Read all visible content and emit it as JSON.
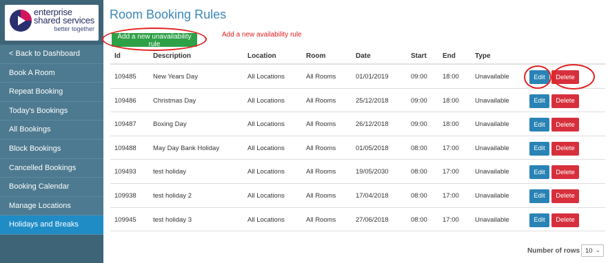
{
  "logo": {
    "line1": "enterprise",
    "line2": "shared services",
    "line3": "better together"
  },
  "sidebar": {
    "items": [
      {
        "label": "< Back to Dashboard"
      },
      {
        "label": "Book A Room"
      },
      {
        "label": "Repeat Booking"
      },
      {
        "label": "Today's Bookings"
      },
      {
        "label": "All Bookings"
      },
      {
        "label": "Block Bookings"
      },
      {
        "label": "Cancelled Bookings"
      },
      {
        "label": "Booking Calendar"
      },
      {
        "label": "Manage Locations"
      },
      {
        "label": "Holidays and Breaks"
      }
    ]
  },
  "main": {
    "title": "Room Booking Rules",
    "add_button_label": "Add a new unavailability rule",
    "annotation": "Add a new availability rule"
  },
  "table": {
    "headers": {
      "id": "Id",
      "description": "Description",
      "location": "Location",
      "room": "Room",
      "date": "Date",
      "start": "Start",
      "end": "End",
      "type": "Type"
    },
    "rows": [
      {
        "id": "109485",
        "description": "New Years Day",
        "location": "All Locations",
        "room": "All Rooms",
        "date": "01/01/2019",
        "start": "09:00",
        "end": "18:00",
        "type": "Unavailable"
      },
      {
        "id": "109486",
        "description": "Christmas Day",
        "location": "All Locations",
        "room": "All Rooms",
        "date": "25/12/2018",
        "start": "09:00",
        "end": "18:00",
        "type": "Unavailable"
      },
      {
        "id": "109487",
        "description": "Boxing Day",
        "location": "All Locations",
        "room": "All Rooms",
        "date": "26/12/2018",
        "start": "09:00",
        "end": "18:00",
        "type": "Unavailable"
      },
      {
        "id": "109488",
        "description": "May Day Bank Holiday",
        "location": "All Locations",
        "room": "All Rooms",
        "date": "01/05/2018",
        "start": "08:00",
        "end": "17:00",
        "type": "Unavailable"
      },
      {
        "id": "109493",
        "description": "test holiday",
        "location": "All Locations",
        "room": "All Rooms",
        "date": "19/05/2030",
        "start": "08:00",
        "end": "17:00",
        "type": "Unavailable"
      },
      {
        "id": "109938",
        "description": "test holiday 2",
        "location": "All Locations",
        "room": "All Rooms",
        "date": "17/04/2018",
        "start": "08:00",
        "end": "17:00",
        "type": "Unavailable"
      },
      {
        "id": "109945",
        "description": "test holiday 3",
        "location": "All Locations",
        "room": "All Rooms",
        "date": "27/06/2018",
        "start": "08:00",
        "end": "17:00",
        "type": "Unavailable"
      }
    ],
    "edit_label": "Edit",
    "delete_label": "Delete"
  },
  "pagination": {
    "rows_label": "Number of rows",
    "rows_value": "10"
  },
  "colors": {
    "sidebar_bg": "#3e6478",
    "nav_item_bg": "#4d7a90",
    "nav_active_bg": "#1f8cc6",
    "title": "#3a87b8",
    "add_button": "#2ea046",
    "edit_button": "#2a83b5",
    "delete_button": "#d7303c",
    "annotation": "#e0201e"
  },
  "icons": {
    "logo": "play-triangle-logo-icon",
    "select": "chevron-down-icon"
  }
}
